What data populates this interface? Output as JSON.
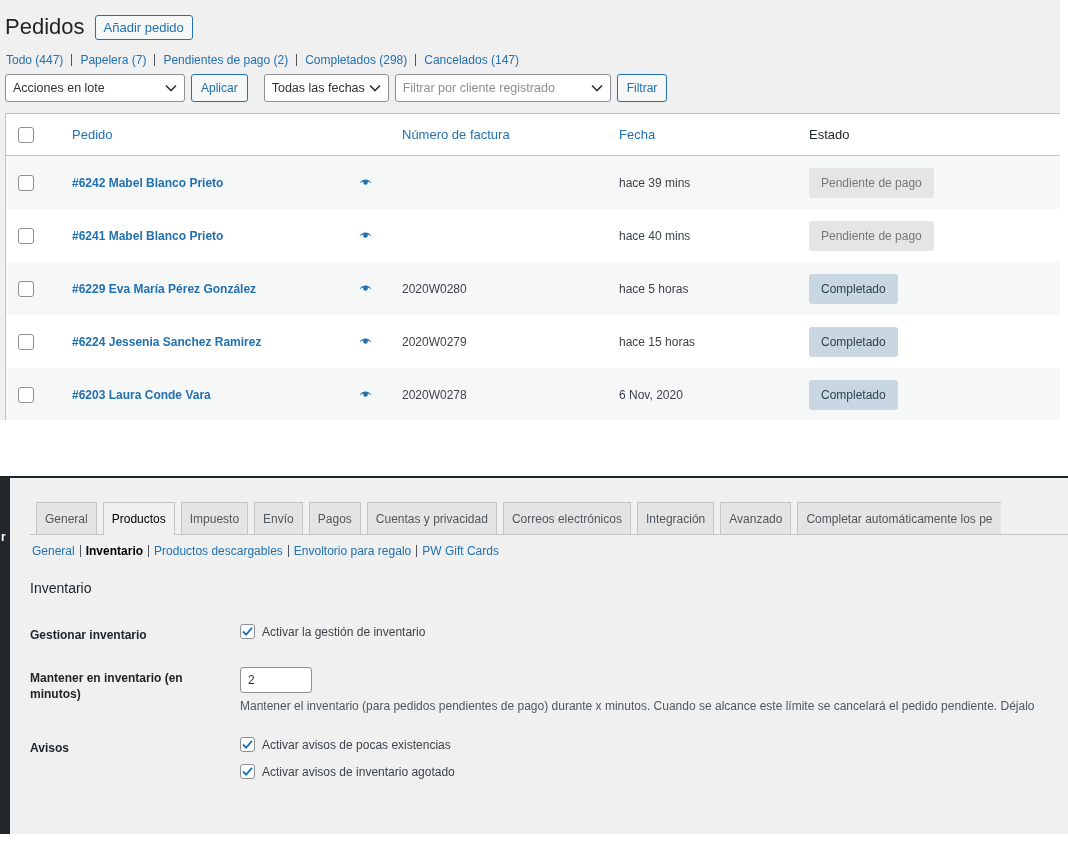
{
  "orders_page": {
    "title": "Pedidos",
    "add_button": "Añadir pedido",
    "filters": [
      "Todo (447)",
      "Papelera (7)",
      "Pendientes de pago (2)",
      "Completados (298)",
      "Cancelados (147)"
    ],
    "bulk_actions": {
      "value": "Acciones en lote"
    },
    "apply_button": "Aplicar",
    "date_filter": {
      "value": "Todas las fechas"
    },
    "customer_filter": {
      "placeholder": "Filtrar por cliente registrado"
    },
    "filter_button": "Filtrar",
    "table": {
      "select_all": {
        "checked": false
      },
      "columns": [
        {
          "label": "Pedido",
          "sortable": true
        },
        {
          "label": "Número de factura",
          "sortable": true
        },
        {
          "label": "Fecha",
          "sortable": true
        },
        {
          "label": "Estado",
          "sortable": false
        }
      ],
      "rows": [
        {
          "checked": false,
          "order": "#6242 Mabel Blanco Prieto",
          "date": "hace 39 mins",
          "status": {
            "label": "Pendiente de pago",
            "kind": "pending"
          }
        },
        {
          "checked": false,
          "order": "#6241 Mabel Blanco Prieto",
          "date": "hace 40 mins",
          "status": {
            "label": "Pendiente de pago",
            "kind": "pending"
          }
        },
        {
          "checked": false,
          "order": "#6229 Eva María Pérez González",
          "invoice": "2020W0280",
          "date": "hace 5 horas",
          "status": {
            "label": "Completado",
            "kind": "completed"
          }
        },
        {
          "checked": false,
          "order": "#6224 Jessenia Sanchez Ramirez",
          "invoice": "2020W0279",
          "date": "hace 15 horas",
          "status": {
            "label": "Completado",
            "kind": "completed"
          }
        },
        {
          "checked": false,
          "order": "#6203 Laura Conde Vara",
          "invoice": "2020W0278",
          "date": "6 Nov, 2020",
          "status": {
            "label": "Completado",
            "kind": "completed"
          }
        }
      ]
    }
  },
  "settings_page": {
    "sidebar_fragment": "r",
    "tabs": [
      {
        "label": "General",
        "selected": false
      },
      {
        "label": "Productos",
        "selected": true
      },
      {
        "label": "Impuesto",
        "selected": false
      },
      {
        "label": "Envío",
        "selected": false
      },
      {
        "label": "Pagos",
        "selected": false
      },
      {
        "label": "Cuentas y privacidad",
        "selected": false
      },
      {
        "label": "Correos electrónicos",
        "selected": false
      },
      {
        "label": "Integración",
        "selected": false
      },
      {
        "label": "Avanzado",
        "selected": false
      },
      {
        "label": "Completar automáticamente los pe",
        "selected": false
      }
    ],
    "subnav": [
      {
        "label": "General",
        "selected": false
      },
      {
        "label": "Inventario",
        "selected": true
      },
      {
        "label": "Productos descargables",
        "selected": false
      },
      {
        "label": "Envoltorio para regalo",
        "selected": false
      },
      {
        "label": "PW Gift Cards",
        "selected": false
      }
    ],
    "section_title": "Inventario",
    "fields": [
      {
        "kind": "checkboxes",
        "label": "Gestionar inventario",
        "options": [
          {
            "label": "Activar la gestión de inventario",
            "checked": true
          }
        ]
      },
      {
        "kind": "number",
        "label": "Mantener en inventario (en minutos)",
        "value": "2",
        "description": "Mantener el inventario (para pedidos pendientes de pago) durante x minutos. Cuando se alcance este límite se cancelará el pedido pendiente. Déjalo"
      },
      {
        "kind": "checkboxes",
        "label": "Avisos",
        "options": [
          {
            "label": "Activar avisos de pocas existencias",
            "checked": true
          },
          {
            "label": "Activar avisos de inventario agotado",
            "checked": true
          }
        ]
      }
    ]
  }
}
